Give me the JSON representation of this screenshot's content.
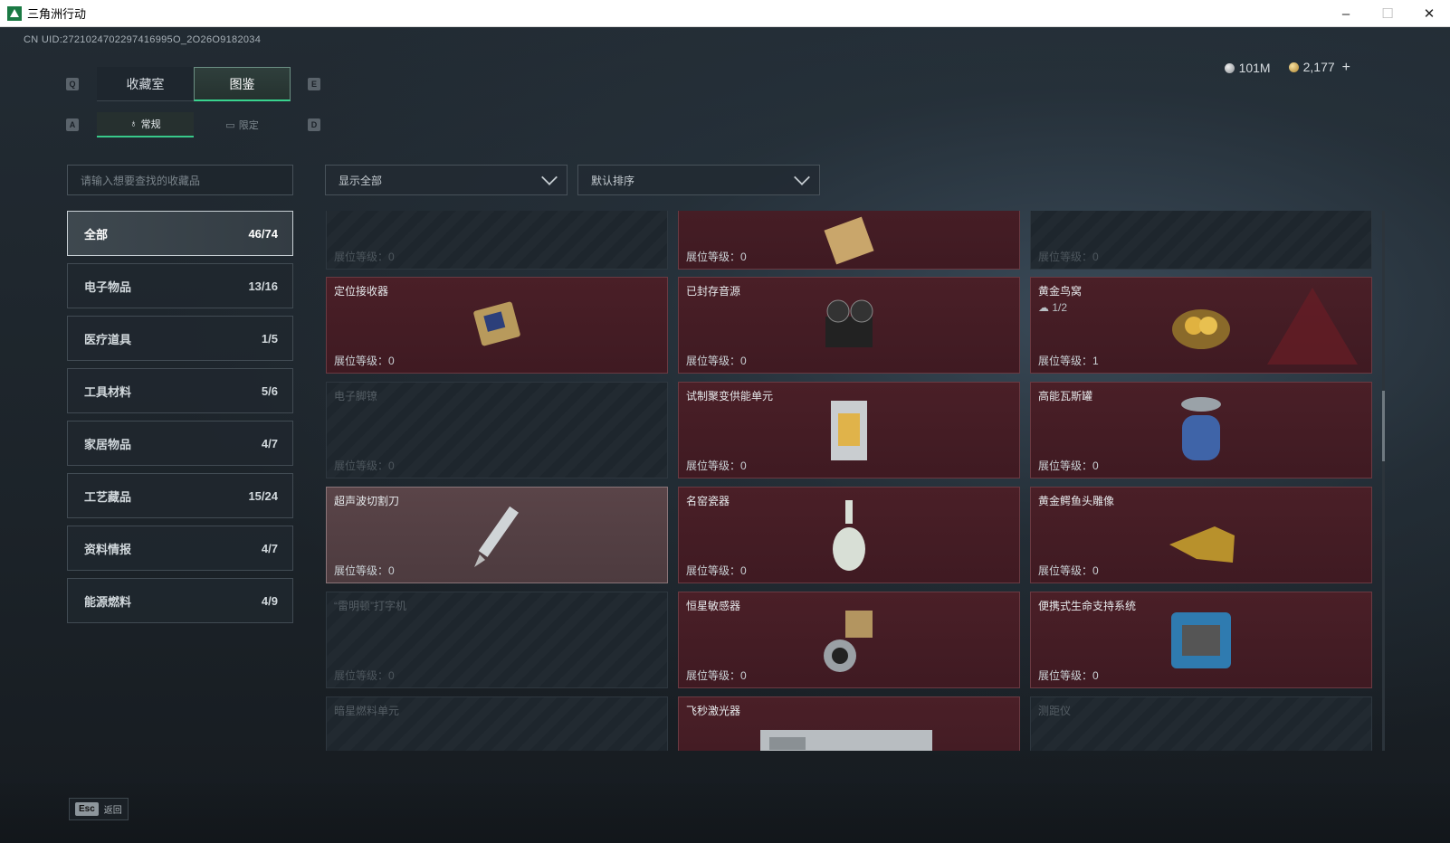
{
  "window": {
    "title": "三角洲行动",
    "minimize": "–",
    "maximize": "☐",
    "close": "✕"
  },
  "uid": "CN UID:2721024702297416995O_2O26O9182034",
  "currency": {
    "silver": "101M",
    "gold": "2,177",
    "plus": "+"
  },
  "keys": {
    "q": "Q",
    "e": "E",
    "a": "A",
    "d": "D"
  },
  "tabs": [
    {
      "label": "收藏室",
      "active": false
    },
    {
      "label": "图鉴",
      "active": true
    }
  ],
  "subtabs": [
    {
      "label": "常规",
      "active": true
    },
    {
      "label": "限定",
      "active": false
    }
  ],
  "search": {
    "placeholder": "请输入想要查找的收藏品"
  },
  "filters": {
    "show": "显示全部",
    "sort": "默认排序"
  },
  "categories": [
    {
      "label": "全部",
      "count": "46/74"
    },
    {
      "label": "电子物品",
      "count": "13/16"
    },
    {
      "label": "医疗道具",
      "count": "1/5"
    },
    {
      "label": "工具材料",
      "count": "5/6"
    },
    {
      "label": "家居物品",
      "count": "4/7"
    },
    {
      "label": "工艺藏品",
      "count": "15/24"
    },
    {
      "label": "资料情报",
      "count": "4/7"
    },
    {
      "label": "能源燃料",
      "count": "4/9"
    }
  ],
  "level_label": "展位等级：",
  "items": [
    {
      "name": "",
      "level": "0",
      "owned": false
    },
    {
      "name": "",
      "level": "0",
      "owned": true
    },
    {
      "name": "",
      "level": "0",
      "owned": false
    },
    {
      "name": "定位接收器",
      "level": "0",
      "owned": true
    },
    {
      "name": "已封存音源",
      "level": "0",
      "owned": true
    },
    {
      "name": "黄金鸟窝",
      "sub": "1/2",
      "level": "1",
      "owned": true
    },
    {
      "name": "电子脚镣",
      "level": "0",
      "owned": false
    },
    {
      "name": "试制聚变供能单元",
      "level": "0",
      "owned": true
    },
    {
      "name": "高能瓦斯罐",
      "level": "0",
      "owned": true
    },
    {
      "name": "超声波切割刀",
      "level": "0",
      "owned": true
    },
    {
      "name": "名窑瓷器",
      "level": "0",
      "owned": true
    },
    {
      "name": "黄金鳄鱼头雕像",
      "level": "0",
      "owned": true
    },
    {
      "name": "“雷明顿”打字机",
      "level": "0",
      "owned": false
    },
    {
      "name": "恒星敏感器",
      "level": "0",
      "owned": true
    },
    {
      "name": "便携式生命支持系统",
      "level": "0",
      "owned": true
    },
    {
      "name": "暗星燃料单元",
      "level": "",
      "owned": false
    },
    {
      "name": "飞秒激光器",
      "level": "",
      "owned": true
    },
    {
      "name": "测距仪",
      "level": "",
      "owned": false
    }
  ],
  "back": {
    "key": "Esc",
    "label": "返回"
  }
}
